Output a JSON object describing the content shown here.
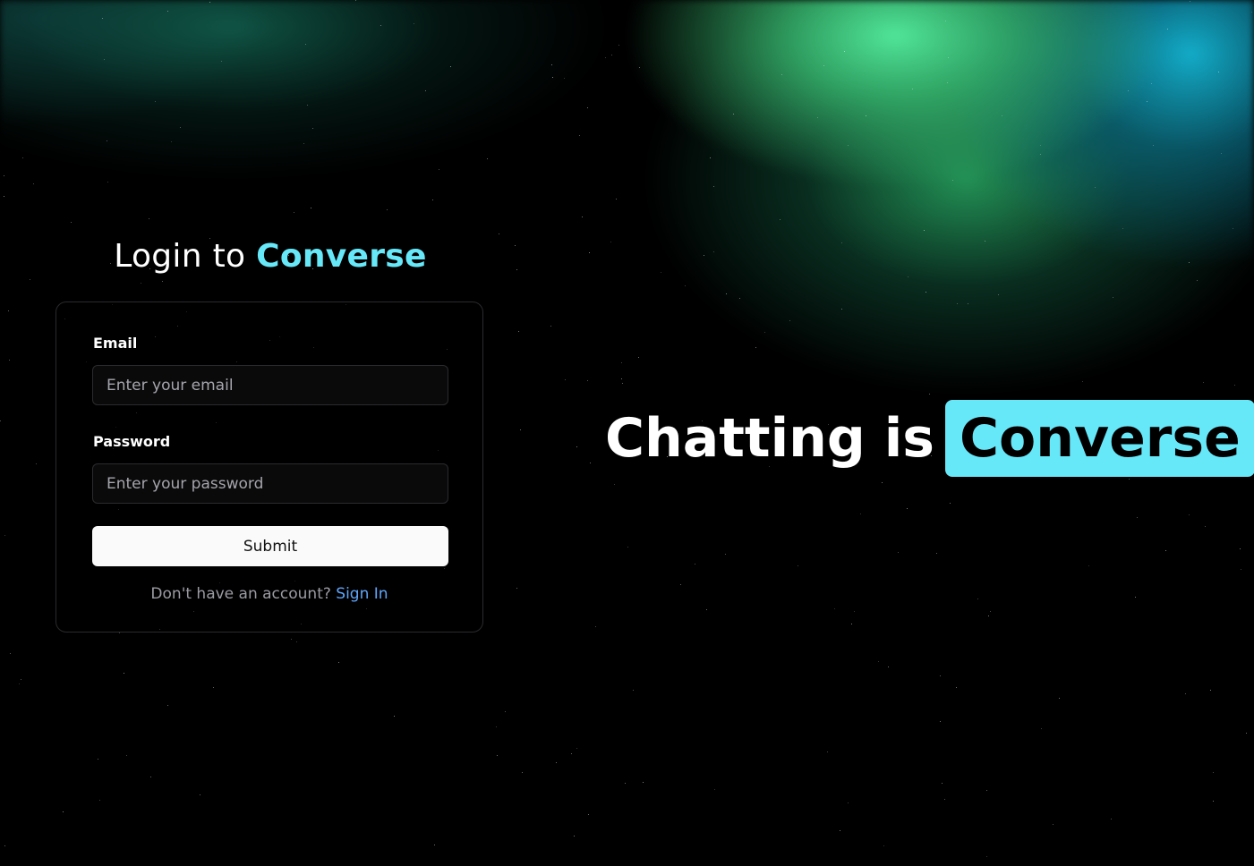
{
  "login": {
    "title_prefix": "Login to",
    "title_brand": "Converse",
    "email_label": "Email",
    "email_placeholder": "Enter your email",
    "email_value": "",
    "password_label": "Password",
    "password_placeholder": "Enter your password",
    "password_value": "",
    "submit_label": "Submit",
    "signup_prompt": "Don't have an account?",
    "signup_link": "Sign In"
  },
  "hero": {
    "text": "Chatting is",
    "highlight": "Converse"
  },
  "colors": {
    "accent": "#67e8f9",
    "link": "#60a5fa",
    "background": "#000000",
    "button_bg": "#fafafa"
  }
}
